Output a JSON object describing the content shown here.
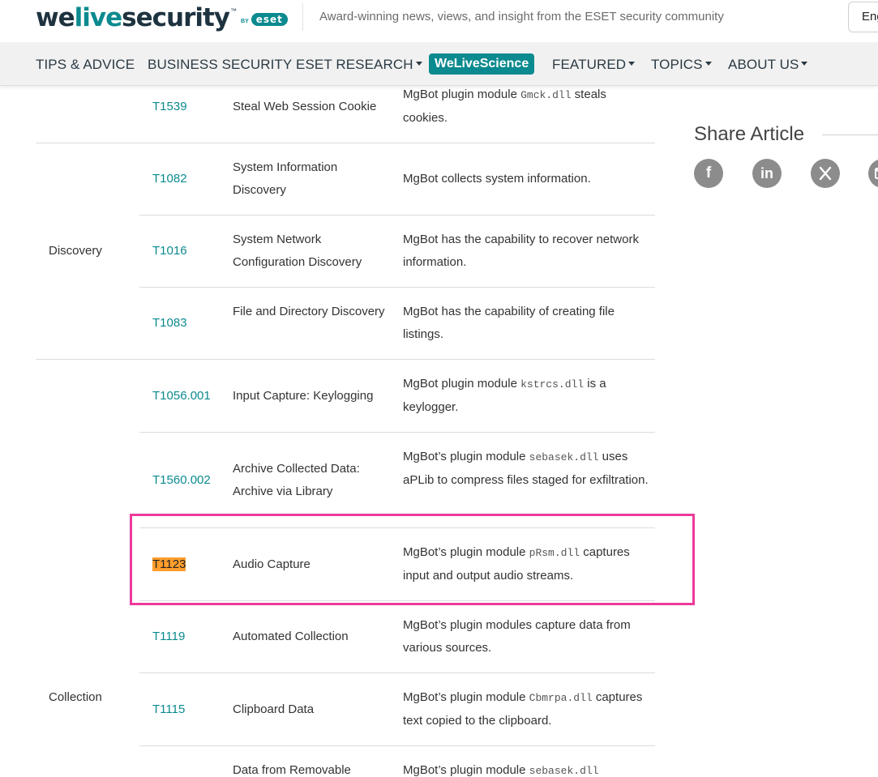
{
  "header": {
    "logo_pre": "we",
    "logo_hl": "live",
    "logo_post": "security",
    "logo_tm": "™",
    "logo_by": "BY",
    "logo_eset": "eset",
    "tagline": "Award-winning news, views, and insight from the ESET security community",
    "lang_button": "Eng"
  },
  "nav": {
    "tips": "TIPS & ADVICE",
    "business": "BUSINESS SECURITY",
    "research": "ESET RESEARCH",
    "science": "WeLiveScience",
    "featured": "FEATURED",
    "topics": "TOPICS",
    "about": "ABOUT US"
  },
  "colors": {
    "brand": "#0b8a8f",
    "highlight_box": "#ec3a9a",
    "id_highlight": "#ff9e2c"
  },
  "table": {
    "tactics": {
      "discovery": "Discovery",
      "collection": "Collection"
    },
    "rows": [
      {
        "id": "T1539",
        "name": "Steal Web Session Cookie",
        "desc": [
          "MgBot plugin module ",
          "Gmck.dll",
          " steals cookies."
        ]
      },
      {
        "id": "T1082",
        "name": "System Information Discovery",
        "desc": [
          "MgBot collects system information."
        ]
      },
      {
        "id": "T1016",
        "name": "System Network Configuration Discovery",
        "desc": [
          "MgBot has the capability to recover network information."
        ]
      },
      {
        "id": "T1083",
        "name": "File and Directory Discovery",
        "desc": [
          "MgBot has the capability of creating file listings."
        ]
      },
      {
        "id": "T1056.001",
        "name": "Input Capture: Keylogging",
        "desc": [
          "MgBot plugin module ",
          "kstrcs.dll",
          " is a keylogger."
        ]
      },
      {
        "id": "T1560.002",
        "name": "Archive Collected Data: Archive via Library",
        "desc": [
          "MgBot’s plugin module ",
          "sebasek.dll",
          " uses aPLib to compress files staged for exfiltration."
        ]
      },
      {
        "id": "T1123",
        "name": "Audio Capture",
        "desc": [
          "MgBot’s plugin module ",
          "pRsm.dll",
          "  captures input and output audio streams."
        ]
      },
      {
        "id": "T1119",
        "name": "Automated Collection",
        "desc": [
          "MgBot’s plugin modules capture data from various sources."
        ]
      },
      {
        "id": "T1115",
        "name": "Clipboard Data",
        "desc": [
          "MgBot’s plugin module ",
          "Cbmrpa.dll",
          " captures text copied to the clipboard."
        ]
      },
      {
        "id": "",
        "name": "Data from Removable",
        "desc": [
          "MgBot’s plugin module ",
          "sebasek.dll"
        ]
      }
    ]
  },
  "share": {
    "title": "Share Article",
    "icons": [
      "facebook-icon",
      "linkedin-icon",
      "x-icon",
      "mail-icon"
    ]
  }
}
